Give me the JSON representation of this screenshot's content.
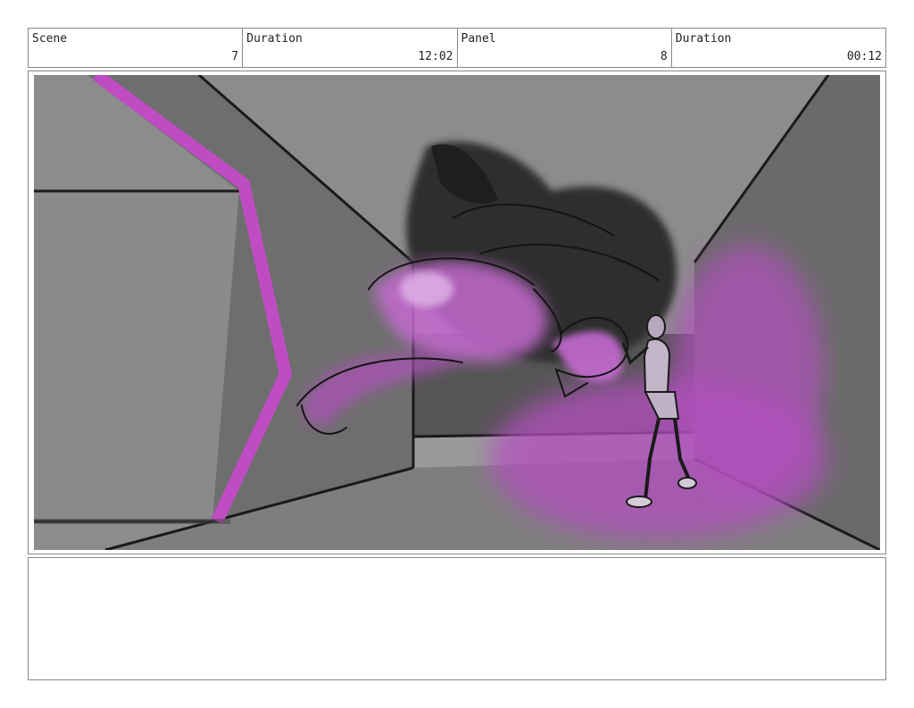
{
  "header": {
    "scene_label": "Scene",
    "scene_value": "7",
    "scene_duration_label": "Duration",
    "scene_duration_value": "12:02",
    "panel_label": "Panel",
    "panel_value": "8",
    "panel_duration_label": "Duration",
    "panel_duration_value": "00:12"
  },
  "notes": {
    "text": ""
  },
  "colors": {
    "accent_magenta": "#c04cc4",
    "glow_purple": "#b44fc0"
  }
}
